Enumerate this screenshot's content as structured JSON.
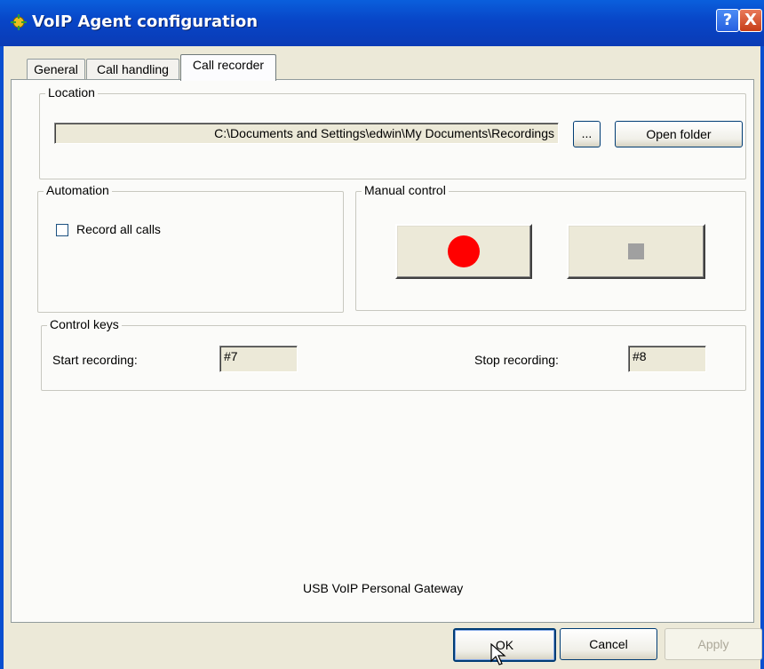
{
  "window": {
    "title": "VoIP Agent configuration",
    "help": "?",
    "close": "X"
  },
  "tabs": [
    "General",
    "Call handling",
    "Call recorder"
  ],
  "location": {
    "legend": "Location",
    "path": "C:\\Documents and Settings\\edwin\\My Documents\\Recordings",
    "browse": "...",
    "open_folder": "Open folder"
  },
  "automation": {
    "legend": "Automation",
    "record_all": "Record all calls",
    "record_all_checked": false
  },
  "manual": {
    "legend": "Manual control"
  },
  "control_keys": {
    "legend": "Control keys",
    "start_label": "Start recording:",
    "start_value": "#7",
    "stop_label": "Stop recording:",
    "stop_value": "#8"
  },
  "footer_text": "USB VoIP Personal Gateway",
  "buttons": {
    "ok": "OK",
    "cancel": "Cancel",
    "apply": "Apply"
  },
  "colors": {
    "record": "#ff0000",
    "stop": "#a0a0a0"
  }
}
